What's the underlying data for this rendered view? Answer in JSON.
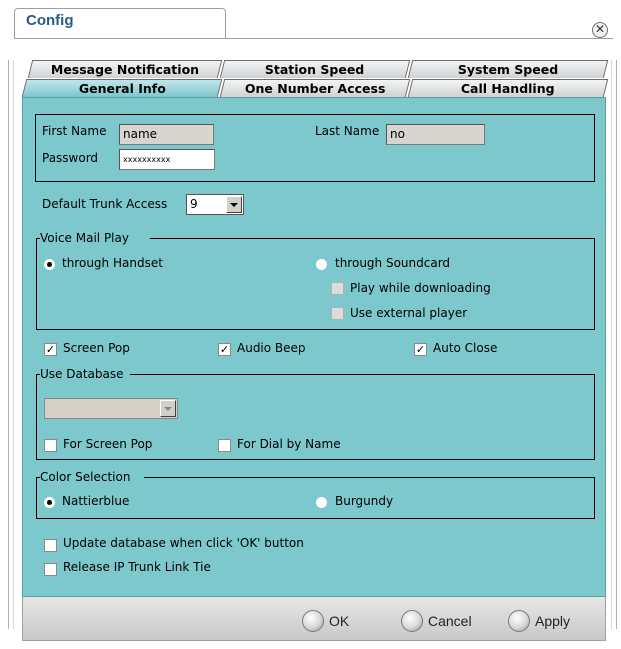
{
  "window": {
    "title": "Config"
  },
  "tabs": {
    "row1": [
      "Message Notification",
      "Station Speed",
      "System Speed"
    ],
    "row2": [
      "General Info",
      "One Number Access",
      "Call Handling"
    ],
    "active": "General Info"
  },
  "account": {
    "first_name_label": "First Name",
    "first_name_value": "name",
    "last_name_label": "Last Name",
    "last_name_value": "no",
    "password_label": "Password",
    "password_value": "xxxxxxxxxx"
  },
  "trunk": {
    "label": "Default Trunk Access",
    "value": "9"
  },
  "voice_mail": {
    "group_label": "Voice Mail Play",
    "through_handset": "through Handset",
    "through_soundcard": "through Soundcard",
    "play_while_downloading": "Play while downloading",
    "use_external_player": "Use external player",
    "selected": "through Handset"
  },
  "options": {
    "screen_pop": "Screen Pop",
    "audio_beep": "Audio Beep",
    "auto_close": "Auto Close"
  },
  "database": {
    "group_label": "Use Database",
    "selected": "",
    "for_screen_pop": "For Screen Pop",
    "for_dial_by_name": "For Dial by Name"
  },
  "color": {
    "group_label": "Color Selection",
    "nattierblue": "Nattierblue",
    "burgundy": "Burgundy",
    "selected": "Nattierblue"
  },
  "misc": {
    "update_database": "Update database when click 'OK' button",
    "release_ip_trunk": "Release IP Trunk Link Tie"
  },
  "buttons": {
    "ok": "OK",
    "cancel": "Cancel",
    "apply": "Apply"
  },
  "colors": {
    "panel": "#7cc8cc",
    "title": "#2b5a8a",
    "active_tab": "#9fd7dc"
  }
}
